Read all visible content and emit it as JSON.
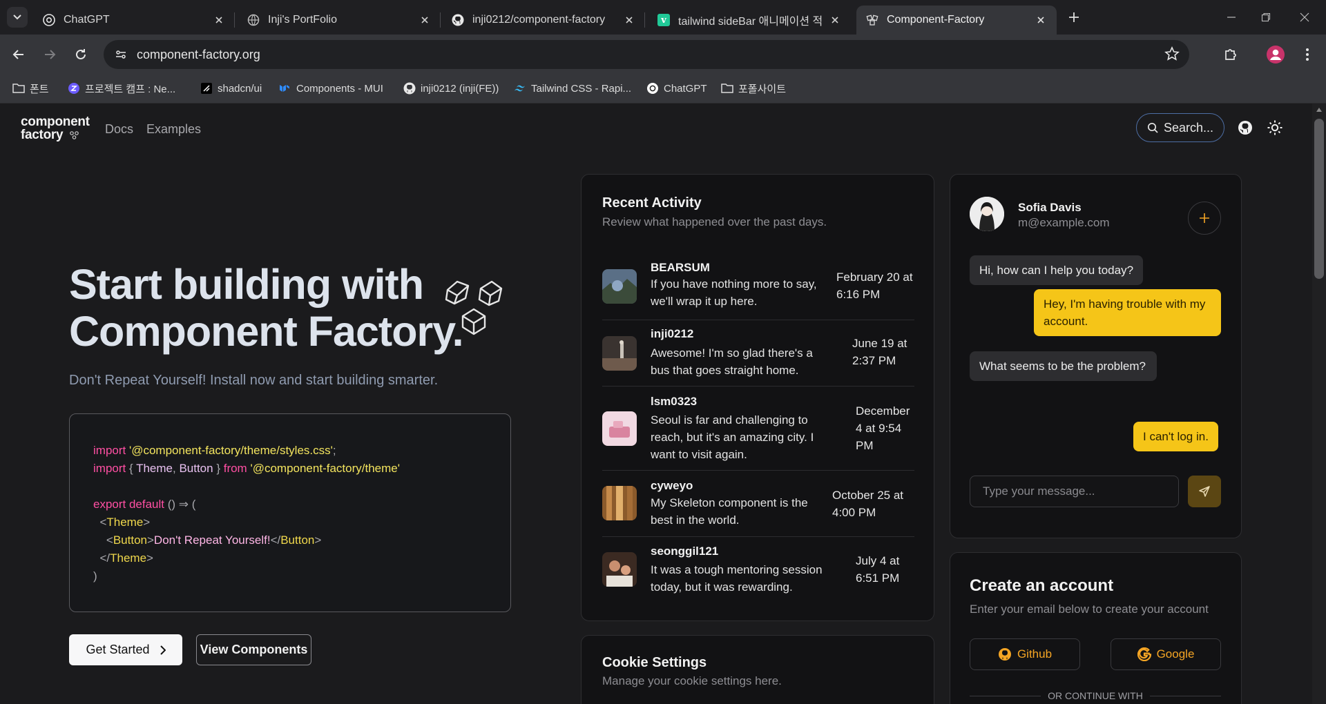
{
  "browser": {
    "tabs": [
      {
        "title": "ChatGPT",
        "icon": "chatgpt-icon"
      },
      {
        "title": "Inji's PortFolio",
        "icon": "globe-icon"
      },
      {
        "title": "inji0212/component-factory",
        "icon": "github-icon"
      },
      {
        "title": "tailwind sideBar 애니메이션 적",
        "icon": "velog-icon"
      },
      {
        "title": "Component-Factory",
        "icon": "component-factory-icon",
        "active": true
      }
    ],
    "url": "component-factory.org",
    "bookmarks": [
      {
        "label": "폰트",
        "icon": "folder-icon"
      },
      {
        "label": "프로젝트 캠프 : Ne...",
        "icon": "zep-icon"
      },
      {
        "label": "shadcn/ui",
        "icon": "shadcn-icon"
      },
      {
        "label": "Components - MUI",
        "icon": "mui-icon"
      },
      {
        "label": "inji0212 (inji(FE))",
        "icon": "github-icon"
      },
      {
        "label": "Tailwind CSS - Rapi...",
        "icon": "tailwind-icon"
      },
      {
        "label": "ChatGPT",
        "icon": "chatgpt-icon"
      },
      {
        "label": "포폴사이트",
        "icon": "folder-icon"
      }
    ]
  },
  "site": {
    "logo_line1": "component",
    "logo_line2": "factory",
    "nav": {
      "docs": "Docs",
      "examples": "Examples"
    },
    "search_label": "Search...",
    "accent": "#f5c518"
  },
  "hero": {
    "title_line1": "Start building with",
    "title_line2": "Component Factory.",
    "subtitle": "Don't Repeat Yourself! Install now and start building smarter.",
    "code": {
      "l1_kw": "import",
      "l1_str": "'@component-factory/theme/styles.css'",
      "l1_end": ";",
      "l2_kw": "import",
      "l2_open": "{ ",
      "l2_a": "Theme",
      "l2_comma": ", ",
      "l2_b": "Button",
      "l2_close": " } ",
      "l2_from": "from",
      "l2_str": "'@component-factory/theme'",
      "l4_kw": "export default",
      "l4_rest": " () ⇒ (",
      "l5_open": "  <",
      "l5_tag": "Theme",
      "l5_close": ">",
      "l6_open": "    <",
      "l6_tag": "Button",
      "l6_gt": ">",
      "l6_text": "Don't Repeat Yourself!",
      "l6_end_open": "</",
      "l6_end_tag": "Button",
      "l6_end_close": ">",
      "l7_open": "  </",
      "l7_tag": "Theme",
      "l7_close": ">",
      "l8": ")"
    },
    "get_started": "Get Started",
    "view_components": "View Components"
  },
  "activity": {
    "title": "Recent Activity",
    "subtitle": "Review what happened over the past days.",
    "items": [
      {
        "user": "BEARSUM",
        "message": "If you have nothing more to say, we'll wrap it up here.",
        "date": "February 20 at 6:16 PM"
      },
      {
        "user": "inji0212",
        "message": "Awesome! I'm so glad there's a bus that goes straight home.",
        "date": "June 19 at 2:37 PM"
      },
      {
        "user": "lsm0323",
        "message": "Seoul is far and challenging to reach, but it's an amazing city. I want to visit again.",
        "date": "December 4 at 9:54 PM"
      },
      {
        "user": "cyweyo",
        "message": "My Skeleton component is the best in the world.",
        "date": "October 25 at 4:00 PM"
      },
      {
        "user": "seonggil121",
        "message": "It was a tough mentoring session today, but it was rewarding.",
        "date": "July 4 at 6:51 PM"
      }
    ]
  },
  "chat": {
    "name": "Sofia Davis",
    "email": "m@example.com",
    "messages": [
      {
        "from": "agent",
        "text": "Hi, how can I help you today?"
      },
      {
        "from": "user",
        "text": "Hey, I'm having trouble with my account."
      },
      {
        "from": "agent",
        "text": "What seems to be the problem?"
      },
      {
        "from": "user",
        "text": "I can't log in."
      }
    ],
    "placeholder": "Type your message..."
  },
  "cookie": {
    "title": "Cookie Settings",
    "subtitle": "Manage your cookie settings here."
  },
  "account": {
    "title": "Create an account",
    "subtitle": "Enter your email below to create your account",
    "github": "Github",
    "google": "Google",
    "or": "OR CONTINUE WITH"
  }
}
